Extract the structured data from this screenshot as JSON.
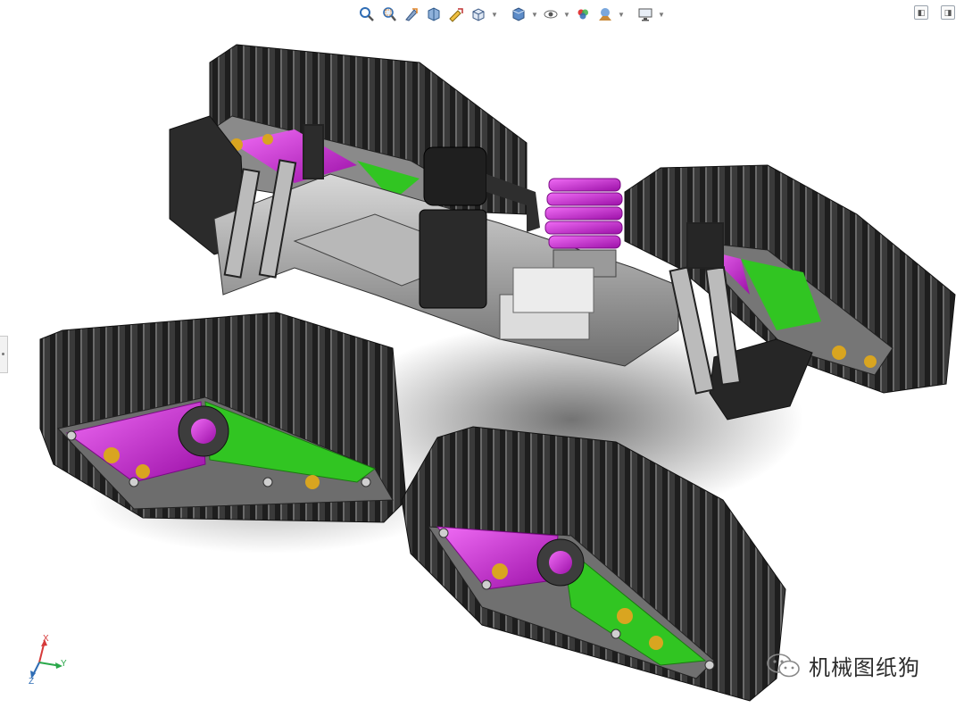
{
  "toolbar": {
    "buttons": [
      {
        "name": "zoom-to-fit-icon"
      },
      {
        "name": "zoom-to-area-icon"
      },
      {
        "name": "previous-view-icon"
      },
      {
        "name": "section-view-icon"
      },
      {
        "name": "dynamic-annotation-icon"
      },
      {
        "name": "view-orientation-icon",
        "caret": true
      },
      {
        "name": "display-style-icon",
        "caret": true
      },
      {
        "name": "hide-show-items-icon",
        "caret": true
      },
      {
        "name": "edit-appearance-icon"
      },
      {
        "name": "apply-scene-icon",
        "caret": true
      },
      {
        "name": "view-settings-icon",
        "caret": true
      }
    ]
  },
  "window_controls": {
    "restore": "◧",
    "maximize": "◨"
  },
  "triad": {
    "x": "X",
    "y": "Y",
    "z": "Z"
  },
  "watermark": {
    "text": "机械图纸狗"
  },
  "colors": {
    "track": "#2a2a2a",
    "track_light": "#5a5a5a",
    "magenta": "#c21ad0",
    "green": "#31c522",
    "gold": "#d9a520",
    "chassis": "#9a9a9a",
    "accent_blue": "#2f6db5"
  }
}
